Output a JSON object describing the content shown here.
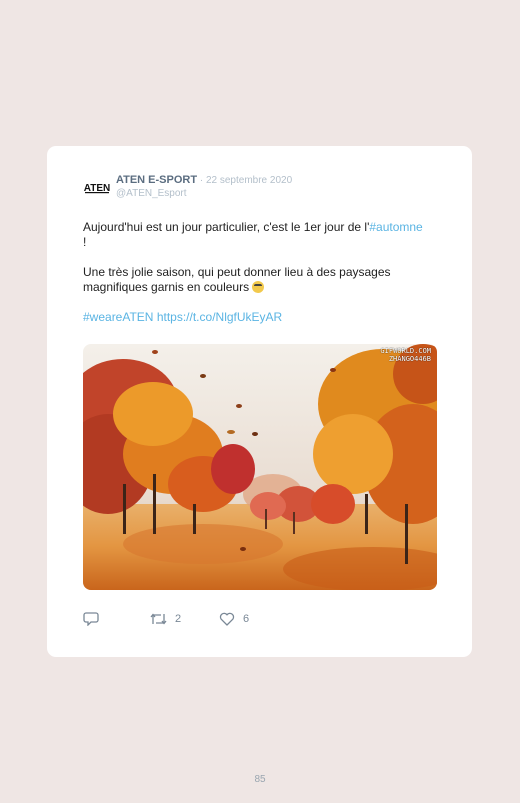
{
  "tweet": {
    "author_name": "ATEN E-SPORT",
    "separator": " · ",
    "date": "22 septembre 2020",
    "handle": "@ATEN_Esport",
    "logo_text": "ATEN",
    "paragraph1_before": "Aujourd'hui est un jour particulier, c'est le 1er jour de l'",
    "paragraph1_hashtag": "#automne",
    "paragraph1_after": " !",
    "paragraph2": "Une très jolie saison, qui peut donner lieu à des paysages magnifiques garnis en couleurs ",
    "emoji": "smiling-face-with-sunglasses",
    "hashtag2": "#weareATEN",
    "url": "https://t.co/NlgfUkEyAR",
    "media_watermark_line1": "GIFWORLD.COM",
    "media_watermark_line2": "ZHANGO446B",
    "reply_icon": "reply-icon",
    "retweet_count": "2",
    "like_count": "6"
  },
  "page": {
    "number": "85"
  },
  "colors": {
    "background": "#efe6e4",
    "card": "#ffffff",
    "link": "#5ab4e3",
    "name": "#5b6d80",
    "muted": "#b3bfca"
  }
}
